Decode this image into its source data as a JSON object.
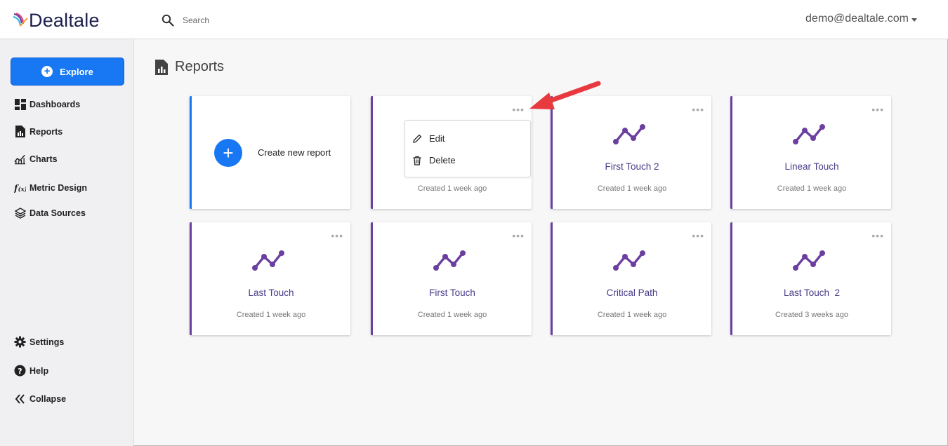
{
  "header": {
    "logo_text": "Dealtale",
    "search_placeholder": "Search",
    "user_email": "demo@dealtale.com"
  },
  "sidebar": {
    "explore_label": "Explore",
    "items": [
      {
        "label": "Dashboards",
        "icon": "dashboard-icon"
      },
      {
        "label": "Reports",
        "icon": "report-icon"
      },
      {
        "label": "Charts",
        "icon": "chart-icon"
      },
      {
        "label": "Metric Design",
        "icon": "function-icon"
      },
      {
        "label": "Data Sources",
        "icon": "layers-icon"
      }
    ],
    "bottom_items": [
      {
        "label": "Settings",
        "icon": "gear-icon"
      },
      {
        "label": "Help",
        "icon": "help-icon"
      },
      {
        "label": "Collapse",
        "icon": "double-chevron-left-icon"
      }
    ]
  },
  "main": {
    "page_title": "Reports",
    "create_label": "Create new report",
    "context_menu": {
      "edit": "Edit",
      "delete": "Delete"
    },
    "cards": [
      {
        "name": "",
        "created": "Created 1 week ago"
      },
      {
        "name": "First Touch 2",
        "created": "Created 1 week ago"
      },
      {
        "name": "Linear Touch",
        "created": "Created 1 week ago"
      },
      {
        "name": "Last Touch",
        "created": "Created 1 week ago"
      },
      {
        "name": "First Touch",
        "created": "Created 1 week ago"
      },
      {
        "name": "Critical Path",
        "created": "Created 1 week ago"
      },
      {
        "name": "Last Touch  2",
        "created": "Created 3 weeks ago"
      }
    ]
  },
  "colors": {
    "primary": "#1877f2",
    "accent": "#6b3fa0",
    "annotation_arrow": "#e8393f"
  }
}
